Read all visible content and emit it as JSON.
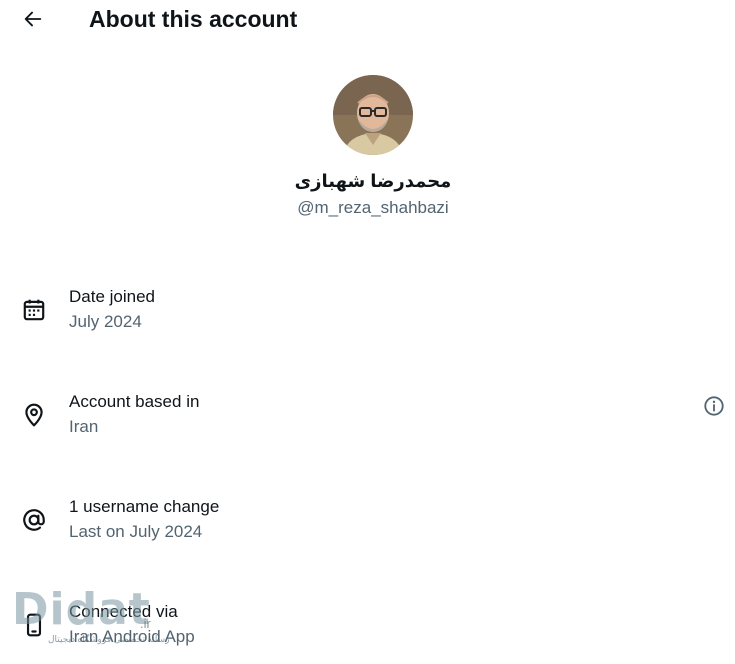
{
  "header": {
    "title": "About this account",
    "back_icon": "arrow-left-icon"
  },
  "profile": {
    "display_name": "محمدرضا شهبازی",
    "handle": "@m_reza_shahbazi"
  },
  "details": [
    {
      "icon": "calendar-icon",
      "label": "Date joined",
      "value": "July 2024"
    },
    {
      "icon": "location-pin-icon",
      "label": "Account based in",
      "value": "Iran",
      "info_icon": "info-icon"
    },
    {
      "icon": "at-sign-icon",
      "label": "1 username change",
      "value": "Last on July 2024"
    },
    {
      "icon": "phone-icon",
      "label": "Connected via",
      "value": "Iran Android App"
    }
  ],
  "watermark": {
    "brand": "Didat",
    "tagline": "رسانه تخصصی فروشگاه دیجیتال",
    "domain": ".ir"
  },
  "colors": {
    "text_primary": "#0f1419",
    "text_secondary": "#536471",
    "background": "#ffffff"
  }
}
